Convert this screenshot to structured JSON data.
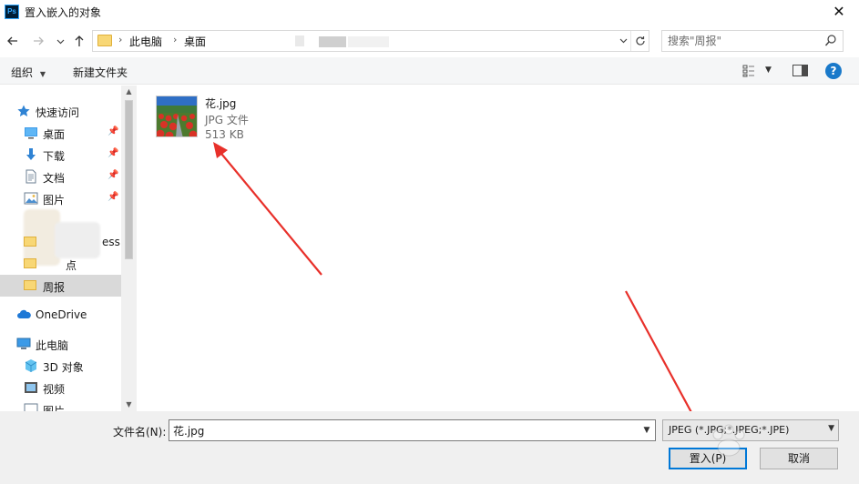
{
  "window": {
    "app_icon_text": "Ps",
    "title": "置入嵌入的对象",
    "close_glyph": "✕"
  },
  "nav": {
    "back_icon": "arrow-left-icon",
    "forward_icon": "arrow-right-icon",
    "recent_icon": "chevron-down-icon",
    "up_icon": "arrow-up-icon"
  },
  "address": {
    "crumbs": [
      "此电脑",
      "桌面"
    ],
    "refresh_icon": "refresh-icon"
  },
  "search": {
    "placeholder": "搜索\"周报\""
  },
  "toolbar": {
    "organize_label": "组织",
    "new_folder_label": "新建文件夹",
    "help_label": "?"
  },
  "sidebar": {
    "quick_access": "快速访问",
    "items": [
      {
        "label": "桌面",
        "pinned": true
      },
      {
        "label": "下载",
        "pinned": true
      },
      {
        "label": "文档",
        "pinned": true
      },
      {
        "label": "图片",
        "pinned": true
      }
    ],
    "partial_items": [
      "ess",
      "点",
      "周报"
    ],
    "onedrive": "OneDrive",
    "this_pc": "此电脑",
    "pc_items": [
      "3D 对象",
      "视频",
      "图片"
    ]
  },
  "files": [
    {
      "name": "花.jpg",
      "type": "JPG 文件",
      "size": "513 KB"
    }
  ],
  "footer": {
    "filename_label": "文件名(N):",
    "filename_value": "花.jpg",
    "filetype_value": "JPEG (*.JPG;*.JPEG;*.JPE)",
    "place_button": "置入(P)",
    "cancel_button": "取消"
  },
  "colors": {
    "accent": "#0078d7",
    "annotation_arrow": "#e8302a",
    "selection": "#d9d9d9"
  }
}
